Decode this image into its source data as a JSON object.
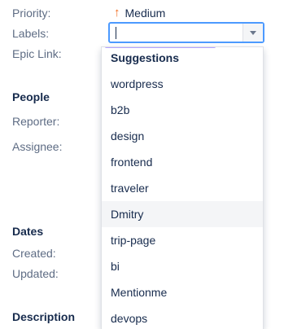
{
  "details": {
    "priority_label": "Priority:",
    "priority_value": "Medium",
    "labels_label": "Labels:",
    "epic_link_label": "Epic Link:"
  },
  "people": {
    "heading": "People",
    "reporter_label": "Reporter:",
    "assignee_label": "Assignee:"
  },
  "dates": {
    "heading": "Dates",
    "created_label": "Created:",
    "updated_label": "Updated:"
  },
  "description": {
    "heading": "Description"
  },
  "labels_input": {
    "value": ""
  },
  "suggestions": {
    "title": "Suggestions",
    "items": [
      "wordpress",
      "b2b",
      "design",
      "frontend",
      "traveler",
      "Dmitry",
      "trip-page",
      "bi",
      "Mentionme",
      "devops"
    ],
    "selected": "Dmitry"
  },
  "colors": {
    "accent": "#4c9aff",
    "priority_arrow": "#f06a1d",
    "highlight": "#f4f5f7"
  }
}
